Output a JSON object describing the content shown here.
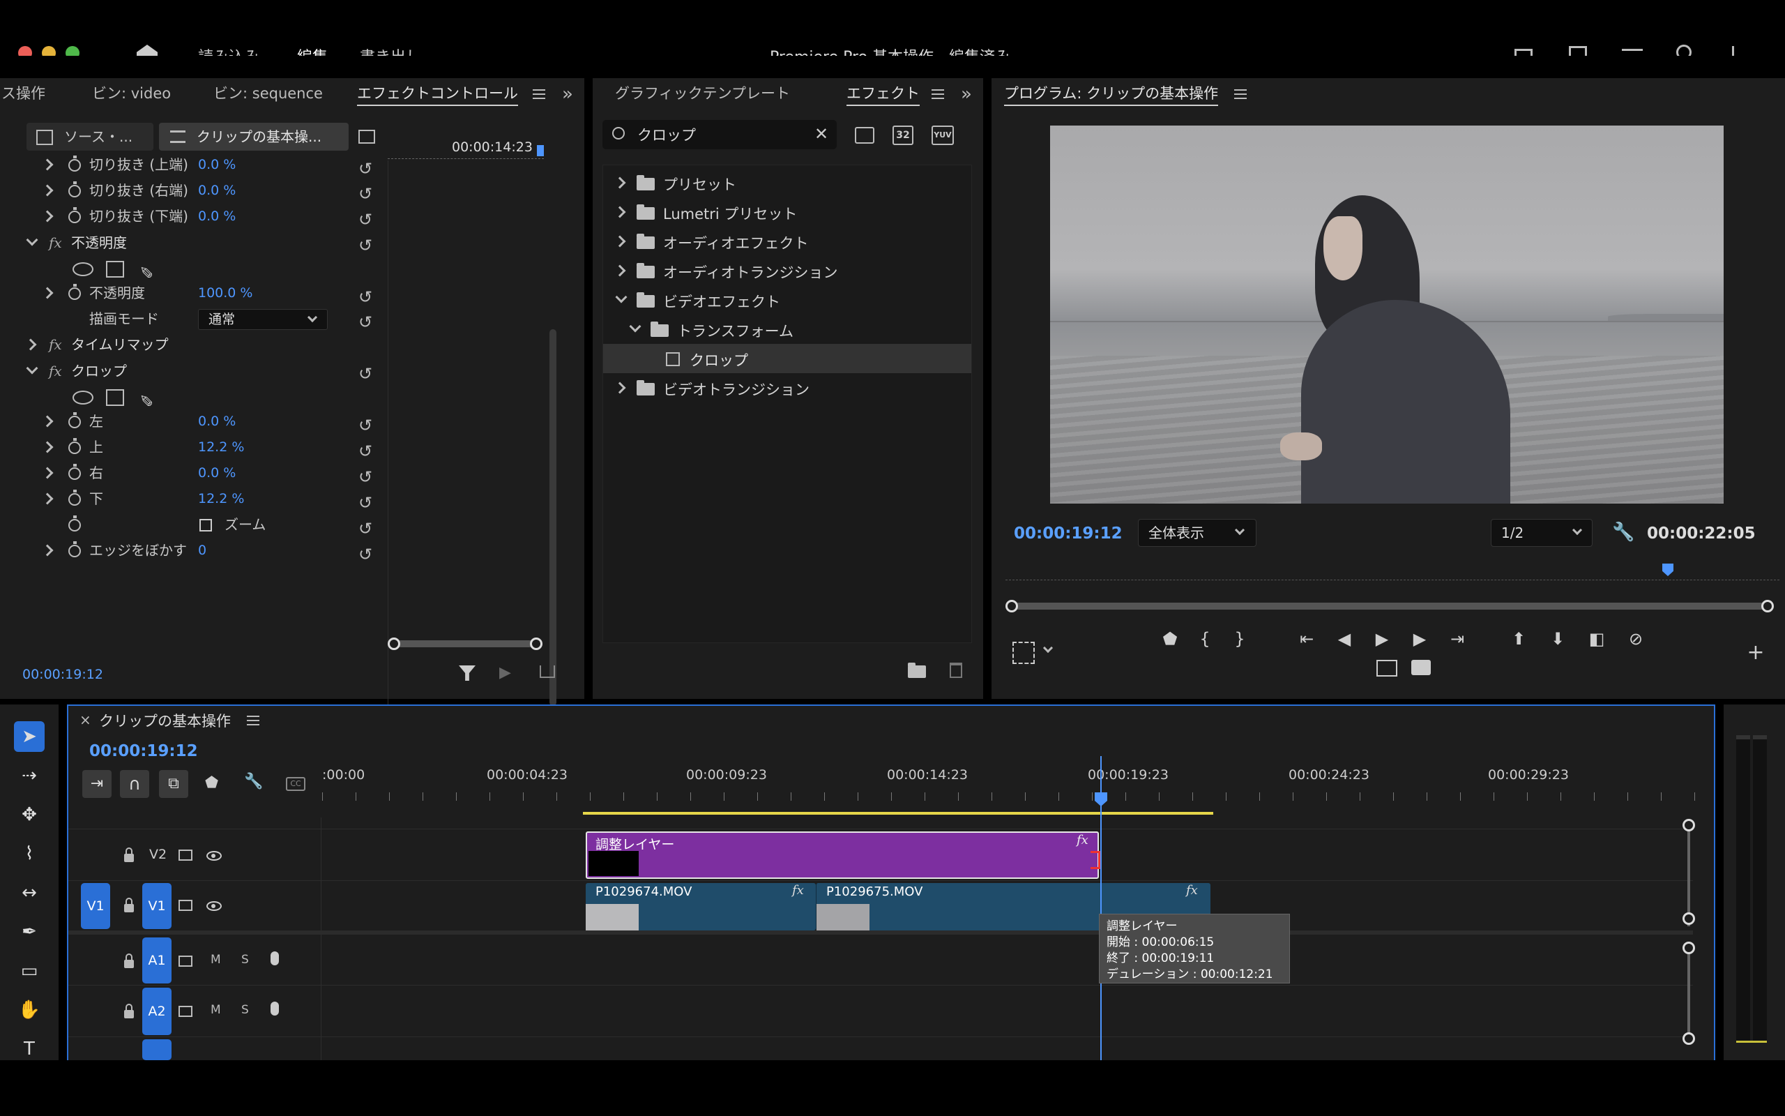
{
  "menubar": {
    "tabs": [
      "読み込み",
      "編集",
      "書き出し"
    ],
    "active_tab": "編集",
    "title": "Premiere Pro 基本操作 - 編集済み"
  },
  "effect_controls": {
    "tabs": [
      "ス操作",
      "ビン: video",
      "ビン: sequence",
      "エフェクトコントロール"
    ],
    "source_btn": "ソース・...",
    "clip_btn": "クリップの基本操...",
    "ruler_time": "00:00:14:23",
    "rows": [
      {
        "label": "切り抜き (上端)",
        "value": "0.0 %"
      },
      {
        "label": "切り抜き (右端)",
        "value": "0.0 %"
      },
      {
        "label": "切り抜き (下端)",
        "value": "0.0 %"
      }
    ],
    "opacity_header": "不透明度",
    "opacity_label": "不透明度",
    "opacity_value": "100.0 %",
    "blend_label": "描画モード",
    "blend_value": "通常",
    "timeremap": "タイムリマップ",
    "crop_header": "クロップ",
    "crop_rows": [
      {
        "label": "左",
        "value": "0.0 %"
      },
      {
        "label": "上",
        "value": "12.2 %"
      },
      {
        "label": "右",
        "value": "0.0 %"
      },
      {
        "label": "下",
        "value": "12.2 %"
      }
    ],
    "zoom_label": "ズーム",
    "feather_label": "エッジをぼかす",
    "feather_value": "0",
    "timecode": "00:00:19:12"
  },
  "effects_panel": {
    "tabs": [
      "グラフィックテンプレート",
      "エフェクト"
    ],
    "search_value": "クロップ",
    "tree": [
      {
        "label": "プリセット",
        "depth": 0,
        "open": false,
        "kind": "preset"
      },
      {
        "label": "Lumetri プリセット",
        "depth": 0,
        "open": false,
        "kind": "preset"
      },
      {
        "label": "オーディオエフェクト",
        "depth": 0,
        "open": false,
        "kind": "folder"
      },
      {
        "label": "オーディオトランジション",
        "depth": 0,
        "open": false,
        "kind": "folder"
      },
      {
        "label": "ビデオエフェクト",
        "depth": 0,
        "open": true,
        "kind": "folder"
      },
      {
        "label": "トランスフォーム",
        "depth": 1,
        "open": true,
        "kind": "folder"
      },
      {
        "label": "クロップ",
        "depth": 2,
        "open": false,
        "kind": "effect"
      },
      {
        "label": "ビデオトランジション",
        "depth": 0,
        "open": false,
        "kind": "folder"
      }
    ]
  },
  "program": {
    "title": "プログラム: クリップの基本操作",
    "timecode": "00:00:19:12",
    "fit": "全体表示",
    "resolution": "1/2",
    "duration": "00:00:22:05"
  },
  "timeline": {
    "title": "クリップの基本操作",
    "timecode": "00:00:19:12",
    "ruler_labels": [
      ":00:00",
      "00:00:04:23",
      "00:00:09:23",
      "00:00:14:23",
      "00:00:19:23",
      "00:00:24:23",
      "00:00:29:23"
    ],
    "tracks": {
      "v2": "V2",
      "v1_src": "V1",
      "v1": "V1",
      "a1": "A1",
      "a2": "A2",
      "m": "M",
      "s": "S"
    },
    "clips": {
      "adjustment": "調整レイヤー",
      "clip1": "P1029674.MOV",
      "clip2": "P1029675.MOV"
    },
    "tooltip": {
      "title": "調整レイヤー",
      "start": "開始 : 00:00:06:15",
      "end": "終了 : 00:00:19:11",
      "duration": "デュレーション : 00:00:12:21"
    }
  },
  "colors": {
    "accent": "#4e96ff",
    "adjustment_clip": "#7d2fa0",
    "video_clip": "#1f4c6a",
    "panel_bg": "#1d1d1d"
  }
}
